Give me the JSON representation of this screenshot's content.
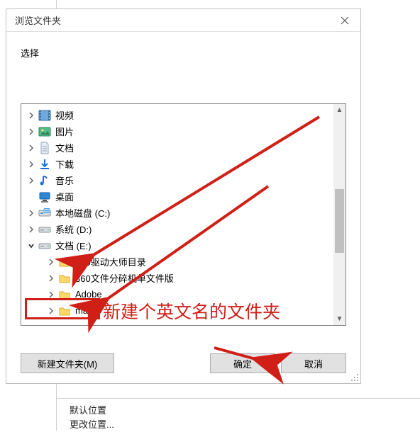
{
  "dialog": {
    "title": "浏览文件夹",
    "prompt": "选择"
  },
  "tree": [
    {
      "depth": 1,
      "expander": "closed",
      "icon": "video",
      "label": "视频"
    },
    {
      "depth": 1,
      "expander": "closed",
      "icon": "picture",
      "label": "图片"
    },
    {
      "depth": 1,
      "expander": "closed",
      "icon": "doc",
      "label": "文档"
    },
    {
      "depth": 1,
      "expander": "closed",
      "icon": "download",
      "label": "下载"
    },
    {
      "depth": 1,
      "expander": "closed",
      "icon": "music",
      "label": "音乐"
    },
    {
      "depth": 1,
      "expander": "none",
      "icon": "desktop",
      "label": "桌面"
    },
    {
      "depth": 1,
      "expander": "closed",
      "icon": "disk-c",
      "label": "本地磁盘 (C:)"
    },
    {
      "depth": 1,
      "expander": "closed",
      "icon": "drive",
      "label": "系统 (D:)"
    },
    {
      "depth": 1,
      "expander": "open",
      "icon": "drive",
      "label": "文档 (E:)"
    },
    {
      "depth": 2,
      "expander": "closed",
      "icon": "folder",
      "label": "360驱动大师目录"
    },
    {
      "depth": 2,
      "expander": "closed",
      "icon": "folder",
      "label": "360文件分碎机单文件版"
    },
    {
      "depth": 2,
      "expander": "closed",
      "icon": "folder",
      "label": "Adobe",
      "highlighted": true
    },
    {
      "depth": 2,
      "expander": "closed",
      "icon": "folder",
      "label": "maya"
    }
  ],
  "buttons": {
    "new_folder": "新建文件夹(M)",
    "ok": "确定",
    "cancel": "取消"
  },
  "annotation": "新建个英文名的文件夹",
  "below": {
    "item1": "默认位置",
    "item2": "更改位置..."
  }
}
